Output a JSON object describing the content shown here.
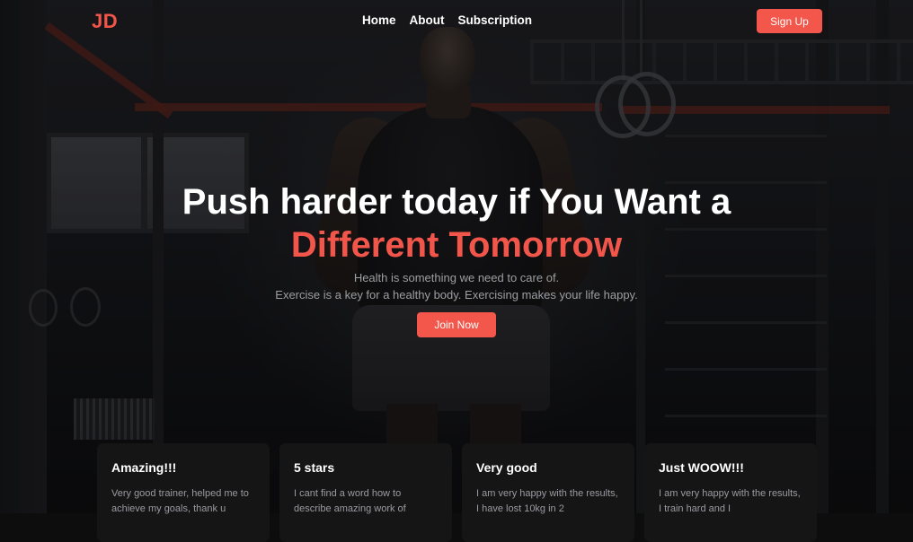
{
  "header": {
    "logo": "JD",
    "nav": [
      {
        "label": "Home"
      },
      {
        "label": "About"
      },
      {
        "label": "Subscription"
      }
    ],
    "signup_label": "Sign Up"
  },
  "hero": {
    "title_line1": "Push harder today if You Want a",
    "title_line2": "Different Tomorrow",
    "subtitle_line1": "Health is something we need to care of.",
    "subtitle_line2": "Exercise is a key for a healthy body. Exercising makes your life happy.",
    "cta_label": "Join Now"
  },
  "reviews": [
    {
      "title": "Amazing!!!",
      "text": "Very good trainer, helped me to achieve my goals, thank u"
    },
    {
      "title": "5 stars",
      "text": "I cant find a word how to describe amazing work of"
    },
    {
      "title": "Very good",
      "text": "I am very happy with the results, I have lost 10kg in 2"
    },
    {
      "title": "Just WOOW!!!",
      "text": "I am very happy with the results, I train hard and I"
    }
  ],
  "colors": {
    "accent": "#f3564a",
    "background": "#0d0d0e",
    "card": "#151516"
  }
}
